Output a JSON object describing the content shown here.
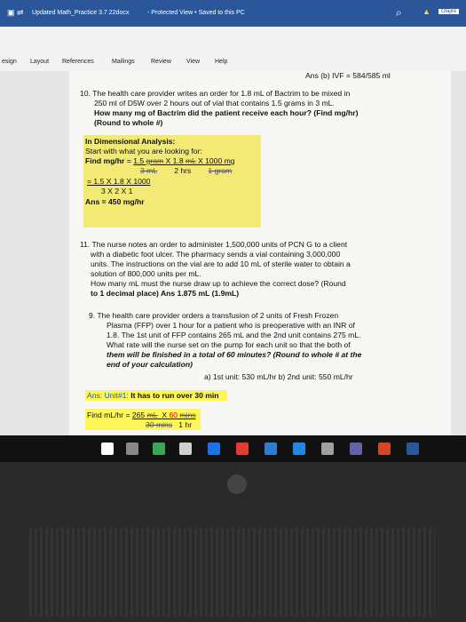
{
  "titlebar": {
    "doc_title": "Updated Math_Practice 3.7.22docx",
    "status": "- Protected View • Saved to this PC",
    "user": "Olajire"
  },
  "ribbon": {
    "tabs": [
      "esign",
      "Layout",
      "References",
      "Mailings",
      "Review",
      "View",
      "Help"
    ]
  },
  "document": {
    "prev_answer": "Ans (b) IVF = 584/585 ml",
    "q10_line1": "10. The health care provider writes an order for 1.8 mL of Bactrim to be mixed in",
    "q10_line2": "250 ml of D5W over 2 hours out of vial that contains 1.5 grams in 3 mL.",
    "q10_line3": "How many mg of Bactrim did the patient receive each hour? (Find mg/hr)",
    "q10_line4": "(Round to whole #)",
    "da_title": "In Dimensional Analysis:",
    "da_start": "Start with what you are looking for:",
    "da_find": "Find mg/hr = 1.5 gram X 1.8 mL X 1000 mg",
    "da_den": "3 mL        2 hrs        1 gram",
    "da_eq1": "= 1.5 X 1.8 X 1000",
    "da_eq2": "3  X  2  X  1",
    "da_ans": "Ans   =   450 mg/hr",
    "q11_line1": "11. The nurse notes an order to administer 1,500,000 units of PCN G to a client",
    "q11_line2": "with a diabetic foot ulcer. The pharmacy sends a vial containing 3,000,000",
    "q11_line3": "units. The instructions on the vial are to add 10 mL of sterile water to obtain a",
    "q11_line4": "solution of 800,000 units per mL.",
    "q11_line5": "How many mL must the nurse draw up to achieve the correct dose? (Round",
    "q11_line6": "to 1 decimal place) Ans 1.875 mL (1.9mL)",
    "q9_line1": "9.   The health care provider orders a transfusion of 2 units of Fresh Frozen",
    "q9_line2": "Plasma (FFP) over 1 hour for a patient who is preoperative with an INR of",
    "q9_line3": "1.8. The 1st unit of FFP contains 265 mL and the 2nd unit contains 275 mL.",
    "q9_line4": "What rate will the nurse set on the pump for each unit so that the both of",
    "q9_line5": "them will be finished in a total of 60 minutes? (Round to whole # at the",
    "q9_line6": "end of your calculation)",
    "q9_answers": "a) 1st unit: 530  mL/hr  b) 2nd unit: 550 mL/hr",
    "unit1": "Ans: Unit#1: It has to run over 30 min",
    "unit1_eq": "Find mL/hr = 265 mL  X 60 mins",
    "unit1_den": "30 mins   1 hr"
  },
  "taskbar": {
    "icons": [
      "start-icon",
      "task-view-icon",
      "photos-icon",
      "word-a-icon",
      "edge-icon",
      "chrome-icon",
      "mail-icon",
      "dropbox-icon",
      "arrow-icon",
      "teams-icon",
      "powerpoint-icon",
      "word-icon"
    ],
    "colors": [
      "#ffffff",
      "#888888",
      "#3aa757",
      "#cfcfcf",
      "#1a73e8",
      "#e53935",
      "#2d7dd2",
      "#1e88e5",
      "#a0a0a0",
      "#6264a7",
      "#d24726",
      "#2b579a"
    ]
  }
}
